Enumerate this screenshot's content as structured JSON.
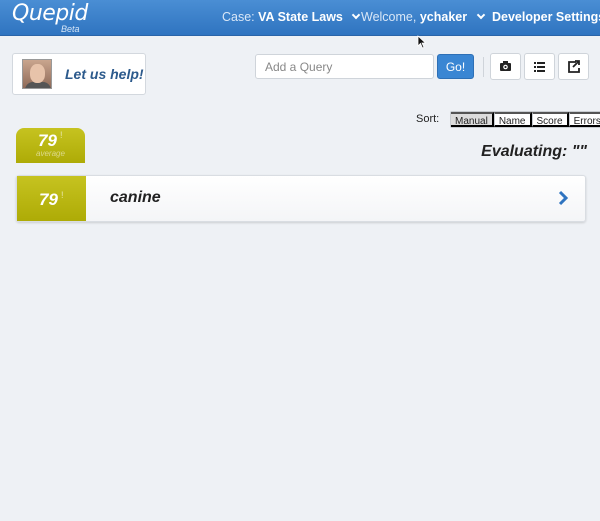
{
  "app": {
    "brand": "Quepid",
    "brand_sub": "Beta"
  },
  "nav": {
    "case_prefix": "Case:",
    "case_name": "VA State Laws",
    "welcome_prefix": "Welcome,",
    "username": "ychaker",
    "developer_settings": "Developer Settings"
  },
  "help": {
    "label": "Let us help!"
  },
  "query_bar": {
    "placeholder": "Add a Query",
    "go_label": "Go!"
  },
  "toolbar_icons": [
    "camera-icon",
    "list-icon",
    "share-icon"
  ],
  "sort": {
    "label": "Sort:",
    "options": [
      "Manual",
      "Name",
      "Score",
      "Errors"
    ],
    "active": "Manual"
  },
  "average": {
    "score": "79",
    "sup": "!",
    "label": "average"
  },
  "evaluating": "Evaluating: \"\"",
  "queries": [
    {
      "score": "79",
      "sup": "!",
      "text": "canine"
    }
  ],
  "colors": {
    "navbar": "#2f74c0",
    "score_tile": "#b8b513",
    "go_button": "#3a86d3",
    "chevron": "#2f74c0"
  }
}
